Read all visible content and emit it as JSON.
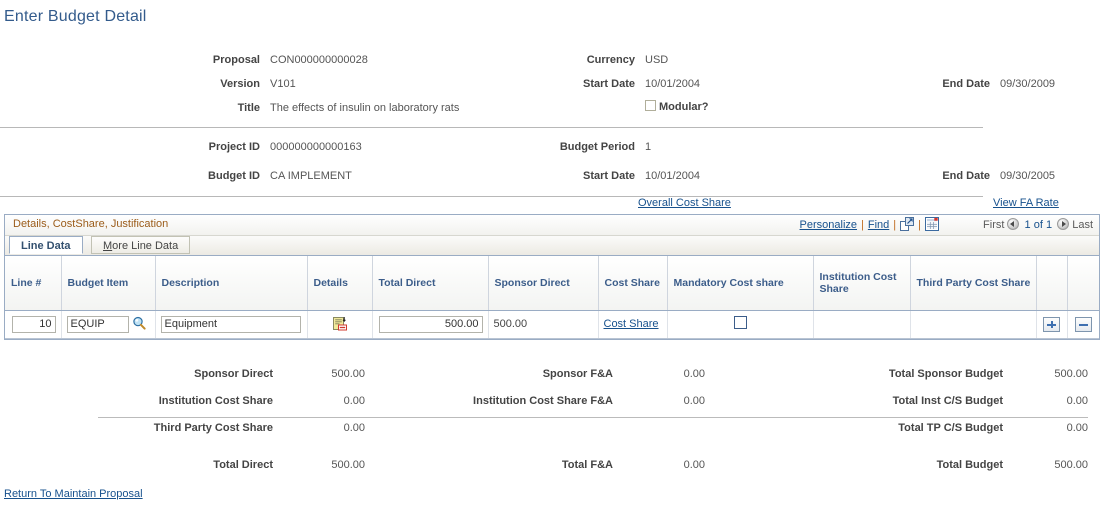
{
  "page": {
    "title": "Enter Budget Detail",
    "footer_link": "Return To Maintain Proposal"
  },
  "header_top": {
    "proposal_label": "Proposal",
    "proposal_value": "CON000000000028",
    "version_label": "Version",
    "version_value": "V101",
    "title_label": "Title",
    "title_value": "The effects of insulin on laboratory rats",
    "currency_label": "Currency",
    "currency_value": "USD",
    "start_date_label": "Start Date",
    "start_date_value": "10/01/2004",
    "end_date_label": "End Date",
    "end_date_value": "09/30/2009",
    "modular_label": "Modular?",
    "modular_checked": false
  },
  "header_bottom": {
    "project_id_label": "Project ID",
    "project_id_value": "000000000000163",
    "budget_id_label": "Budget ID",
    "budget_id_value": "CA IMPLEMENT",
    "budget_period_label": "Budget Period",
    "budget_period_value": "1",
    "start_date_label": "Start Date",
    "start_date_value": "10/01/2004",
    "end_date_label": "End Date",
    "end_date_value": "09/30/2005"
  },
  "section_links": {
    "overall_cost_share": "Overall Cost Share",
    "view_fa_rate_pre": "View F",
    "view_fa_rate_key": "A",
    "view_fa_rate_post": " Rate"
  },
  "grid": {
    "title": "Details, CostShare, Justification",
    "toolbar": {
      "personalize": "Personalize",
      "find": "Find",
      "separator": "|",
      "expand_icon": "expand-icon",
      "download_icon": "spreadsheet-download-icon"
    },
    "nav": {
      "first": "First",
      "counter": "1 of 1",
      "last": "Last",
      "prev_icon": "previous-arrow-icon",
      "next_icon": "next-arrow-icon"
    },
    "tabs": [
      {
        "label": "Line Data",
        "active": true
      },
      {
        "label_pre": "",
        "accesskey": "M",
        "label_post": "ore Line Data",
        "label": "More Line Data",
        "active": false
      }
    ],
    "columns": [
      "Line #",
      "Budget Item",
      "Description",
      "Details",
      "Total Direct",
      "Sponsor Direct",
      "Cost Share",
      "Mandatory Cost share",
      "Institution Cost Share",
      "Third Party Cost Share",
      "",
      ""
    ],
    "rows": [
      {
        "line_no": "10",
        "budget_item": "EQUIP",
        "lookup_icon": "magnifier-lookup-icon",
        "description": "Equipment",
        "details_icon": "details-document-icon",
        "total_direct": "500.00",
        "sponsor_direct": "500.00",
        "cost_share_link": "Cost Share",
        "mandatory_cost_share_checked": false,
        "institution_cost_share": "",
        "third_party_cost_share": "",
        "add_row_icon": "add-row-icon",
        "delete_row_icon": "delete-row-icon"
      }
    ]
  },
  "totals": {
    "col1": [
      {
        "label": "Sponsor Direct",
        "value": "500.00"
      },
      {
        "label": "Institution Cost Share",
        "value": "0.00"
      },
      {
        "label": "Third Party Cost Share",
        "value": "0.00"
      },
      {
        "label": "Total Direct",
        "value": "500.00"
      }
    ],
    "col2": [
      {
        "label": "Sponsor F&A",
        "value": "0.00"
      },
      {
        "label": "Institution Cost Share F&A",
        "value": "0.00"
      },
      {
        "label": "",
        "value": ""
      },
      {
        "label": "Total F&A",
        "value": "0.00"
      }
    ],
    "col3": [
      {
        "label": "Total Sponsor Budget",
        "value": "500.00"
      },
      {
        "label": "Total Inst C/S Budget",
        "value": "0.00"
      },
      {
        "label": "Total TP C/S Budget",
        "value": "0.00"
      },
      {
        "label": "Total Budget",
        "value": "500.00"
      }
    ]
  },
  "colors": {
    "title_blue": "#335b8c",
    "link_blue": "#17518d",
    "grid_title_orange": "#9b5c1a",
    "column_header_blue": "#3c5d8a"
  }
}
